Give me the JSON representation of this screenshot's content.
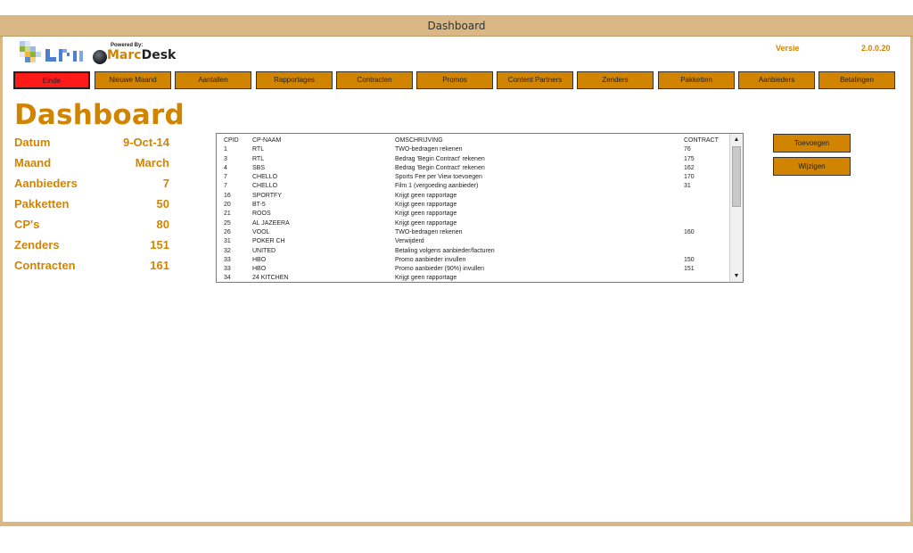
{
  "window": {
    "title": "Dashboard"
  },
  "header": {
    "powered_by": "Powered By:",
    "brand_prefix": "Marc",
    "brand_suffix": "Desk",
    "versie_label": "Versie",
    "versie_value": "2.0.0.20"
  },
  "nav": [
    "Einde",
    "Nieuwe Maand",
    "Aantallen",
    "Rapportages",
    "Contracten",
    "Promos",
    "Content Partners",
    "Zenders",
    "Pakketten",
    "Aanbieders",
    "Betalingen"
  ],
  "page_title": "Dashboard",
  "stats": [
    {
      "label": "Datum",
      "value": "9-Oct-14"
    },
    {
      "label": "Maand",
      "value": "March"
    },
    {
      "label": "Aanbieders",
      "value": "7"
    },
    {
      "label": "Pakketten",
      "value": "50"
    },
    {
      "label": "CP's",
      "value": "80"
    },
    {
      "label": "Zenders",
      "value": "151"
    },
    {
      "label": "Contracten",
      "value": "161"
    }
  ],
  "list": {
    "headers": [
      "CPID",
      "CP-NAAM",
      "OMSCHRIJVING",
      "CONTRACT"
    ],
    "rows": [
      [
        "1",
        "RTL",
        "TWO-bedragen rekenen",
        "76"
      ],
      [
        "3",
        "RTL",
        "Bedrag 'Begin Contract' rekenen",
        "175"
      ],
      [
        "4",
        "SBS",
        "Bedrag 'Begin Contract' rekenen",
        "162"
      ],
      [
        "7",
        "CHELLO",
        "Sports Fee per View toevoegen",
        "170"
      ],
      [
        "7",
        "CHELLO",
        "Film 1 (vergoeding aanbieder)",
        "31"
      ],
      [
        "16",
        "SPORTFY",
        "Krijgt geen rapportage",
        ""
      ],
      [
        "20",
        "BT-5",
        "Krijgt geen rapportage",
        ""
      ],
      [
        "21",
        "ROOS",
        "Krijgt geen rapportage",
        ""
      ],
      [
        "25",
        "AL JAZEERA",
        "Krijgt geen rapportage",
        ""
      ],
      [
        "26",
        "VOOL",
        "TWO-bedragen rekenen",
        "160"
      ],
      [
        "31",
        "POKER CH",
        "Verwijderd",
        ""
      ],
      [
        "32",
        "UNITED",
        "Betaling volgens aanbieder/facturen",
        ""
      ],
      [
        "33",
        "HBO",
        "Promo aanbieder invullen",
        "150"
      ],
      [
        "33",
        "HBO",
        "Promo aanbieder (90%) invullen",
        "151"
      ],
      [
        "34",
        "24 KITCHEN",
        "Krijgt geen rapportage",
        ""
      ]
    ]
  },
  "actions": {
    "add": "Toevoegen",
    "edit": "Wijzigen"
  },
  "colors": {
    "accent": "#d18400",
    "exit": "#ff1a1a",
    "frame": "#d9b885"
  }
}
